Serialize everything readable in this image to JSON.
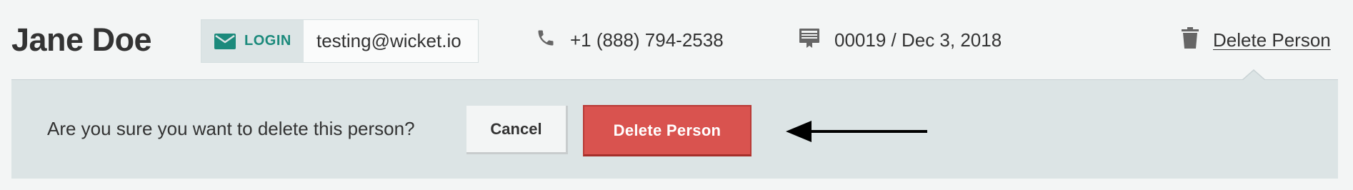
{
  "person": {
    "name": "Jane Doe"
  },
  "login": {
    "label": "LOGIN",
    "email": "testing@wicket.io",
    "icon": "envelope-icon"
  },
  "contact": {
    "phone": "+1 (888) 794-2538",
    "phone_icon": "phone-icon",
    "record": "00019 / Dec 3, 2018",
    "record_icon": "id-card-icon"
  },
  "actions": {
    "delete_link_label": "Delete Person",
    "delete_icon": "trash-icon"
  },
  "confirm": {
    "question": "Are you sure you want to delete this person?",
    "cancel_label": "Cancel",
    "delete_label": "Delete Person"
  },
  "colors": {
    "accent": "#1c8a7c",
    "danger": "#d9534f",
    "panel": "#dce4e5",
    "background": "#f3f5f5"
  }
}
